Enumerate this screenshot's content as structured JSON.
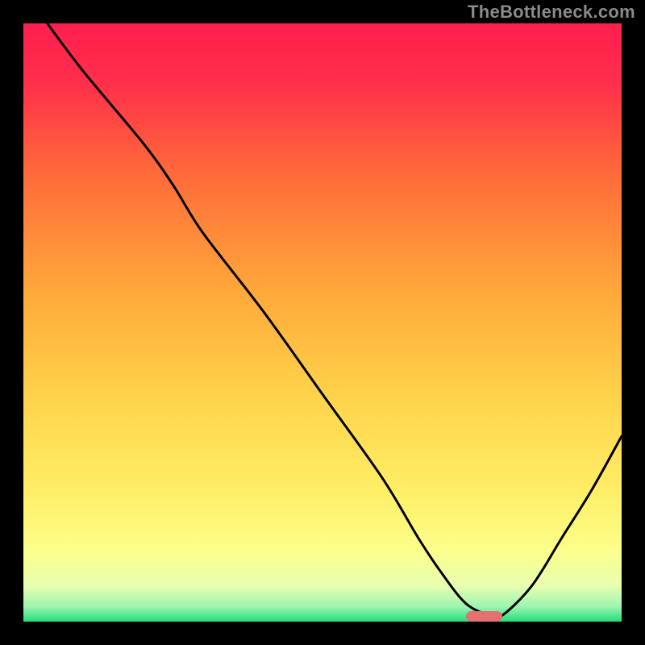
{
  "watermark": "TheBottleneck.com",
  "chart_data": {
    "type": "line",
    "title": "",
    "xlabel": "",
    "ylabel": "",
    "xlim": [
      0,
      100
    ],
    "ylim": [
      0,
      100
    ],
    "x": [
      4,
      10,
      20,
      25,
      30,
      40,
      50,
      60,
      66,
      70,
      74,
      78,
      80,
      85,
      90,
      95,
      100
    ],
    "values": [
      100,
      92,
      80,
      73,
      65,
      52,
      38,
      24,
      14,
      8,
      3,
      1,
      1,
      6,
      14,
      22,
      31
    ],
    "optimum_marker_x": [
      74,
      80
    ],
    "gradient_stops": [
      {
        "pos": 0.0,
        "color": "#ff1f4f"
      },
      {
        "pos": 0.1,
        "color": "#ff2f4a"
      },
      {
        "pos": 0.25,
        "color": "#ff6a3a"
      },
      {
        "pos": 0.45,
        "color": "#ffa93a"
      },
      {
        "pos": 0.62,
        "color": "#ffd24a"
      },
      {
        "pos": 0.78,
        "color": "#ffee66"
      },
      {
        "pos": 0.88,
        "color": "#fcff8a"
      },
      {
        "pos": 0.94,
        "color": "#e9ffb0"
      },
      {
        "pos": 0.975,
        "color": "#9cf5b0"
      },
      {
        "pos": 1.0,
        "color": "#23dd7a"
      }
    ],
    "marker_color": "#e76f6f"
  }
}
